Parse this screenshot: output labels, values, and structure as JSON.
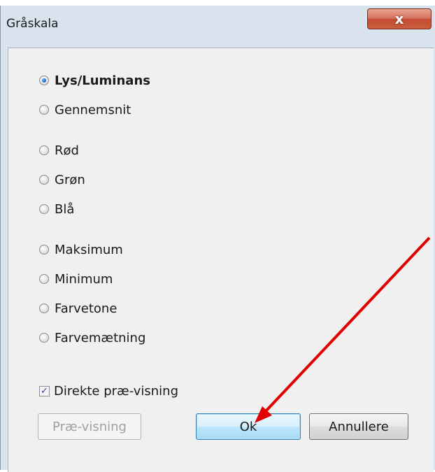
{
  "window": {
    "title": "Gråskala",
    "close_label": "x"
  },
  "options": {
    "lys": "Lys/Luminans",
    "gennemsnit": "Gennemsnit",
    "rod": "Rød",
    "gron": "Grøn",
    "bla": "Blå",
    "maksimum": "Maksimum",
    "minimum": "Minimum",
    "farvetone": "Farvetone",
    "farvemaetning": "Farvemætning",
    "selected": "Lys/Luminans"
  },
  "preview_checkbox": {
    "label": "Direkte præ-visning",
    "checked": true
  },
  "buttons": {
    "preview": "Præ-visning",
    "ok": "Ok",
    "cancel": "Annullere"
  },
  "colors": {
    "annotation_arrow": "#e00000",
    "window_frame": "#d9e3ed",
    "client_bg": "#f0f0f0"
  }
}
